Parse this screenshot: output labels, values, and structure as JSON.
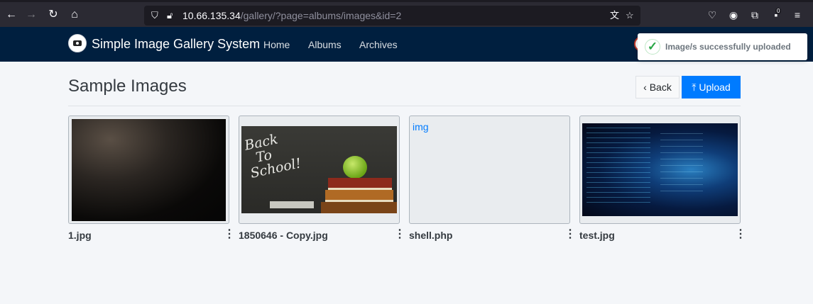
{
  "browser": {
    "url_host": "10.66.135.34",
    "url_path": "/gallery/?page=albums/images&id=2",
    "extension_badge": "0"
  },
  "app": {
    "brand": "Simple Image Gallery System",
    "nav": [
      "Home",
      "Albums",
      "Archives"
    ]
  },
  "toast": {
    "message": "Image/s successfully uploaded"
  },
  "page": {
    "title": "Sample Images",
    "back_label": "Back",
    "upload_label": "Upload"
  },
  "images": [
    {
      "name": "1.jpg"
    },
    {
      "name": "1850646 - Copy.jpg",
      "chalk_text": "Back\nTo\nSchool!"
    },
    {
      "name": "shell.php",
      "broken_alt": "img"
    },
    {
      "name": "test.jpg"
    }
  ],
  "colors": {
    "navbar": "#001f3f",
    "primary": "#007bff",
    "success": "#28a745",
    "page_bg": "#f4f6f9"
  }
}
